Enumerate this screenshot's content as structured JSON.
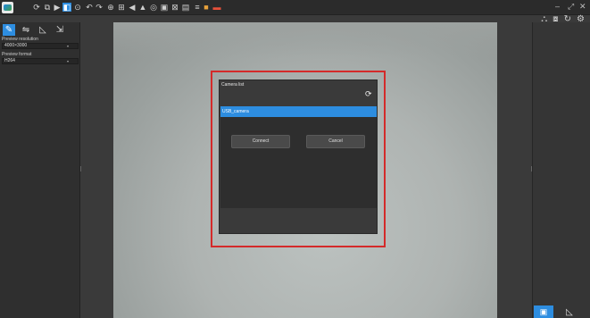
{
  "toolbar": {
    "icons": [
      {
        "name": "rotate-icon",
        "glyph": "⟳"
      },
      {
        "name": "copy-icon",
        "glyph": "⧉"
      },
      {
        "name": "play-icon",
        "glyph": "▶"
      },
      {
        "name": "camera-select-icon",
        "glyph": "◧"
      },
      {
        "name": "snapshot-icon",
        "glyph": "⊙"
      },
      {
        "name": "undo-icon",
        "glyph": "↶"
      },
      {
        "name": "redo-icon",
        "glyph": "↷"
      },
      {
        "name": "zoom-icon",
        "glyph": "⊕"
      },
      {
        "name": "grid-icon",
        "glyph": "⊞"
      },
      {
        "name": "flip-icon",
        "glyph": "◀"
      },
      {
        "name": "mountain-icon",
        "glyph": "▲"
      },
      {
        "name": "camera-icon",
        "glyph": "◎"
      },
      {
        "name": "image-icon",
        "glyph": "▣"
      },
      {
        "name": "composite-icon",
        "glyph": "⊠"
      },
      {
        "name": "measure-icon",
        "glyph": "▤"
      },
      {
        "name": "settings-icon",
        "glyph": "≡"
      },
      {
        "name": "color-icon",
        "glyph": "■"
      },
      {
        "name": "palette-icon",
        "glyph": "▬"
      }
    ]
  },
  "window_controls": {
    "minimize": "–",
    "restore": "⤢",
    "close": "✕"
  },
  "right_icons": [
    {
      "name": "network-icon",
      "glyph": "⛬"
    },
    {
      "name": "capture-icon",
      "glyph": "⧇"
    },
    {
      "name": "refresh-icon",
      "glyph": "↻"
    },
    {
      "name": "gear-icon",
      "glyph": "⚙"
    }
  ],
  "left_panel": {
    "tabs": [
      {
        "name": "tab-camera",
        "glyph": "✎"
      },
      {
        "name": "tab-adjust",
        "glyph": "⇋"
      },
      {
        "name": "tab-measure",
        "glyph": "◺"
      },
      {
        "name": "tab-export",
        "glyph": "⇲"
      }
    ],
    "preview_resolution_label": "Preview resolution",
    "preview_resolution_value": "4000×3000",
    "preview_format_label": "Preview format",
    "preview_format_value": "H264"
  },
  "dialog": {
    "title": "Camera list",
    "items": [
      "USB_camera"
    ],
    "selected_index": 0,
    "connect_label": "Connect",
    "cancel_label": "Cancel"
  },
  "right_panel": {
    "bottom_tabs": [
      {
        "name": "tab-image",
        "glyph": "▣"
      },
      {
        "name": "tab-measure-right",
        "glyph": "◺"
      }
    ]
  },
  "colors": {
    "accent": "#2d8de0",
    "highlight": "#d42a2a"
  }
}
